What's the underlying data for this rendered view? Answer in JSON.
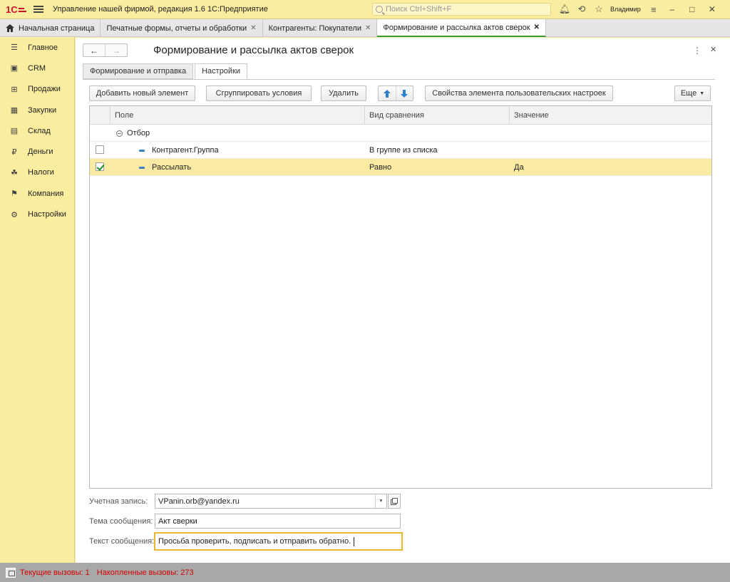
{
  "titlebar": {
    "app_title": "Управление нашей фирмой, редакция 1.6 1С:Предприятие",
    "search_placeholder": "Поиск Ctrl+Shift+F",
    "user": "Владимир"
  },
  "tabs": [
    {
      "label": "Начальная страница"
    },
    {
      "label": "Печатные формы, отчеты и обработки"
    },
    {
      "label": "Контрагенты: Покупатели"
    },
    {
      "label": "Формирование и рассылка актов сверок"
    }
  ],
  "sidebar": {
    "items": [
      {
        "label": "Главное",
        "icon": "menu-icon"
      },
      {
        "label": "CRM",
        "icon": "crm-icon"
      },
      {
        "label": "Продажи",
        "icon": "sales-icon"
      },
      {
        "label": "Закупки",
        "icon": "purchases-icon"
      },
      {
        "label": "Склад",
        "icon": "warehouse-icon"
      },
      {
        "label": "Деньги",
        "icon": "money-icon"
      },
      {
        "label": "Налоги",
        "icon": "taxes-icon"
      },
      {
        "label": "Компания",
        "icon": "flag-icon"
      },
      {
        "label": "Настройки",
        "icon": "gear-icon"
      }
    ]
  },
  "form": {
    "title": "Формирование и рассылка актов сверок",
    "tabs": [
      {
        "label": "Формирование и отправка"
      },
      {
        "label": "Настройки"
      }
    ],
    "buttons": {
      "add": "Добавить новый элемент",
      "group": "Сгруппировать условия",
      "delete": "Удалить",
      "properties": "Свойства элемента пользовательских настроек",
      "more": "Еще"
    },
    "table": {
      "columns": [
        "Поле",
        "Вид сравнения",
        "Значение"
      ],
      "group_label": "Отбор",
      "rows": [
        {
          "field": "Контрагент.Группа",
          "comparison": "В группе из списка",
          "value": "",
          "checked": false
        },
        {
          "field": "Рассылать",
          "comparison": "Равно",
          "value": "Да",
          "checked": true
        }
      ]
    },
    "fields": {
      "account_label": "Учетная запись:",
      "account_value": "VPanin.orb@yandex.ru",
      "subject_label": "Тема сообщения:",
      "subject_value": "Акт сверки",
      "text_label": "Текст сообщения:",
      "text_value": "Просьба проверить, подписать и отправить обратно."
    }
  },
  "statusbar": {
    "current_calls": "Текущие вызовы: 1",
    "accum_calls": "Накопленные вызовы: 273"
  },
  "colors": {
    "accent": "#fbeda0",
    "selection": "#fbeaa3",
    "status_text": "#d20000",
    "active_tab_underline": "#3a9a3a"
  }
}
